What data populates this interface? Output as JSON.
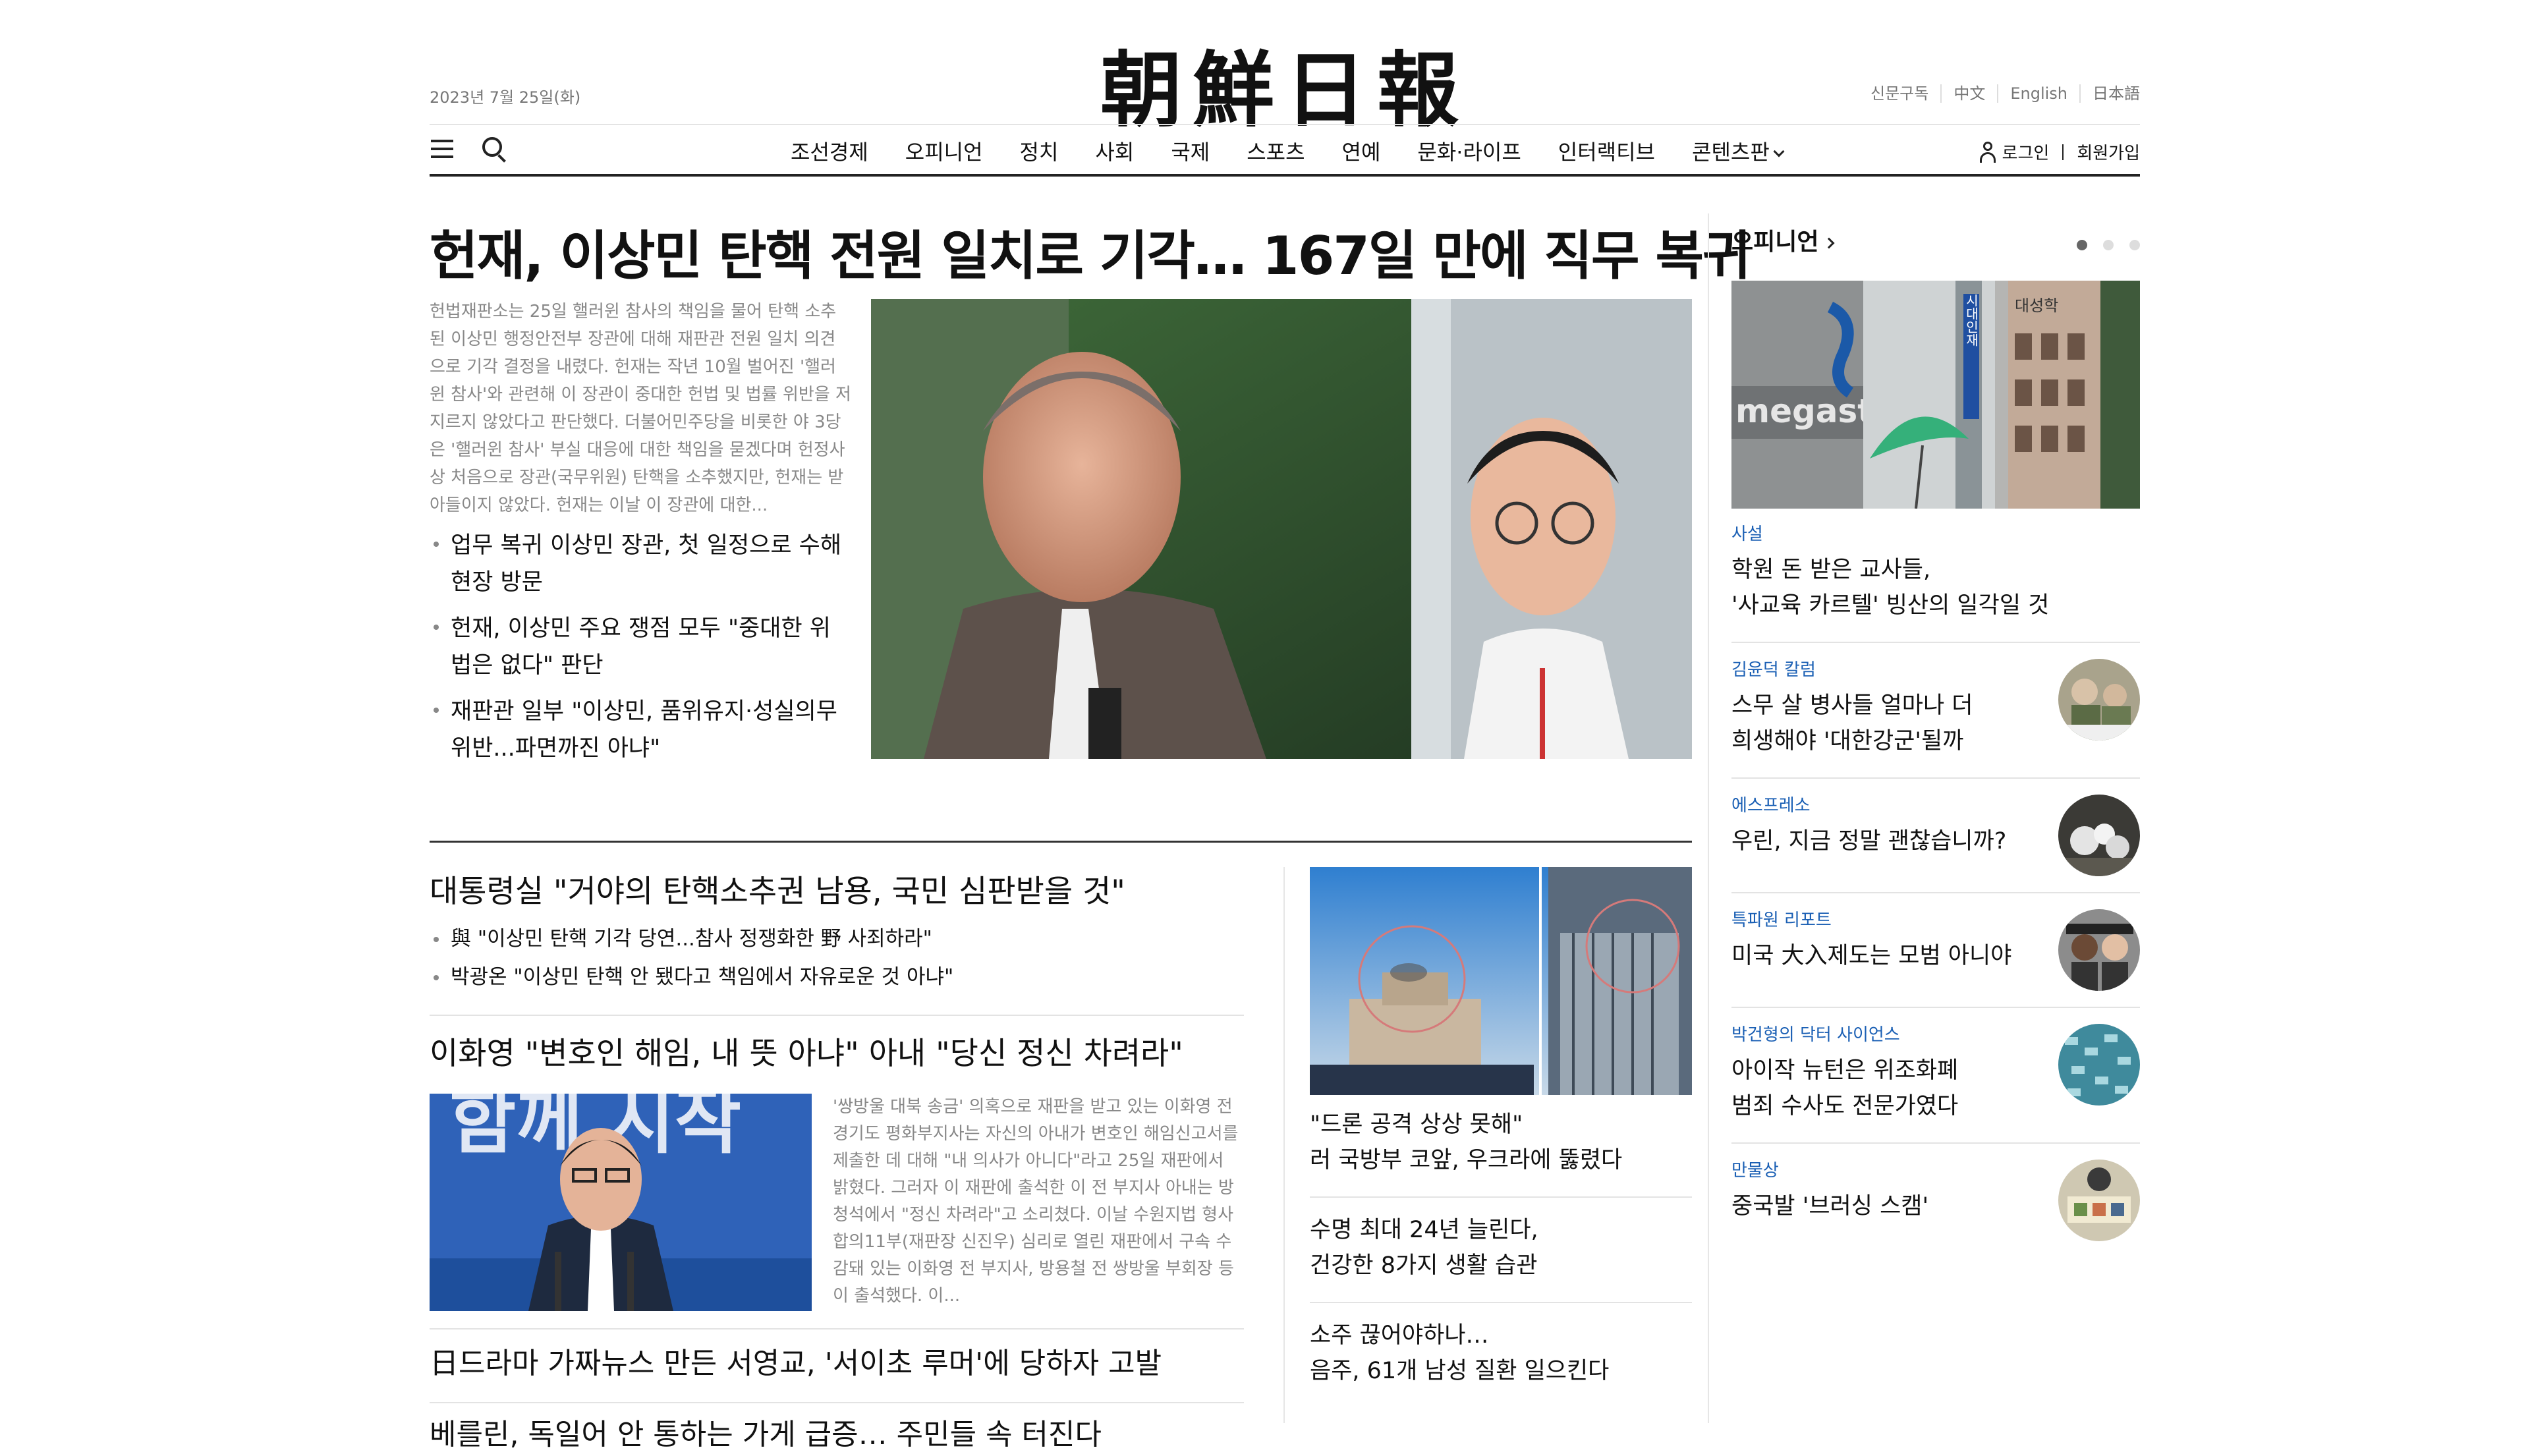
{
  "header": {
    "date": "2023년 7월 25일(화)",
    "logo": "朝鮮日報",
    "top_links": [
      "신문구독",
      "中文",
      "English",
      "日本語"
    ],
    "nav": [
      "조선경제",
      "오피니언",
      "정치",
      "사회",
      "국제",
      "스포츠",
      "연예",
      "문화·라이프",
      "인터랙티브",
      "콘텐츠판"
    ],
    "login": "로그인",
    "signup": "회원가입"
  },
  "lead": {
    "headline": "헌재, 이상민 탄핵 전원 일치로 기각… 167일 만에 직무 복귀",
    "summary": "헌법재판소는 25일 핼러윈 참사의 책임을 물어 탄핵 소추된 이상민 행정안전부 장관에 대해 재판관 전원 일치 의견으로 기각 결정을 내렸다. 헌재는 작년 10월 벌어진 '핼러윈 참사'와 관련해 이 장관이 중대한 헌법 및 법률 위반을 저지르지 않았다고 판단했다. 더불어민주당을 비롯한 야 3당은 '핼러윈 참사' 부실 대응에 대한 책임을 묻겠다며 헌정사상 처음으로 장관(국무위원) 탄핵을 소추했지만, 헌재는 받아들이지 않았다. 헌재는 이날 이 장관에 대한...",
    "related": [
      "업무 복귀 이상민 장관, 첫 일정으로 수해현장 방문",
      "헌재, 이상민 주요 쟁점 모두 \"중대한 위법은 없다\" 판단",
      "재판관 일부 \"이상민, 품위유지·성실의무 위반...파면까진 아냐\""
    ]
  },
  "stories": {
    "s1": {
      "title": "대통령실 \"거야의 탄핵소추권 남용, 국민 심판받을 것\"",
      "subs": [
        "與 \"이상민 탄핵 기각 당연...참사 정쟁화한 野 사죄하라\"",
        "박광온 \"이상민 탄핵 안 됐다고 책임에서 자유로운 것 아냐\""
      ]
    },
    "s2": {
      "title": "이화영 \"변호인 해임, 내 뜻 아냐\" 아내 \"당신 정신 차려라\"",
      "summary": "'쌍방울 대북 송금' 의혹으로 재판을 받고 있는 이화영 전 경기도 평화부지사는 자신의 아내가 변호인 해임신고서를 제출한 데 대해 \"내 의사가 아니다\"라고 25일 재판에서 밝혔다. 그러자 이 재판에 출석한 이 전 부지사 아내는 방청석에서 \"정신 차려라\"고 소리쳤다. 이날 수원지법 형사합의11부(재판장 신진우) 심리로 열린 재판에서 구속 수감돼 있는 이화영 전 부지사, 방용철 전 쌍방울 부회장 등이 출석했다. 이..."
    },
    "s3": "日드라마 가짜뉴스 만든 서영교, '서이초 루머'에 당하자 고발",
    "s4": "베를린, 독일어 안 통하는 가게 급증… 주민들 속 터진다",
    "mid": [
      "\"드론 공격 상상 못해\" 러 국방부 코앞, 우크라에 뚫렸다",
      "수명 최대 24년 늘린다, 건강한 8가지 생활 습관",
      "소주 끊어야하나… 음주, 61개 남성 질환 일으킨다"
    ],
    "mid_lines": [
      [
        "\"드론 공격 상상 못해\"",
        "러 국방부 코앞, 우크라에 뚫렸다"
      ],
      [
        "수명 최대 24년 늘린다,",
        "건강한 8가지 생활 습관"
      ],
      [
        "소주 끊어야하나…",
        "음주, 61개 남성 질환 일으킨다"
      ]
    ]
  },
  "opinion": {
    "heading": "오피니언",
    "items": [
      {
        "category": "사설",
        "title": [
          "학원 돈 받은 교사들,",
          "'사교육 카르텔' 빙산의 일각일 것"
        ]
      },
      {
        "category": "김윤덕 칼럼",
        "title": [
          "스무 살 병사들 얼마나 더",
          "희생해야 '대한강군'될까"
        ]
      },
      {
        "category": "에스프레소",
        "title": [
          "우린, 지금 정말 괜찮습니까?"
        ]
      },
      {
        "category": "특파원 리포트",
        "title": [
          "미국 大入제도는 모범 아니야"
        ]
      },
      {
        "category": "박건형의 닥터 사이언스",
        "title": [
          "아이작 뉴턴은 위조화폐",
          "범죄 수사도 전문가였다"
        ]
      },
      {
        "category": "만물상",
        "title": [
          "중국발 '브러싱 스캠'"
        ]
      }
    ]
  },
  "image_text": {
    "megastudy": "megastu",
    "sign": "시대인재",
    "univ": "대성학",
    "banner": "함께 시작"
  }
}
